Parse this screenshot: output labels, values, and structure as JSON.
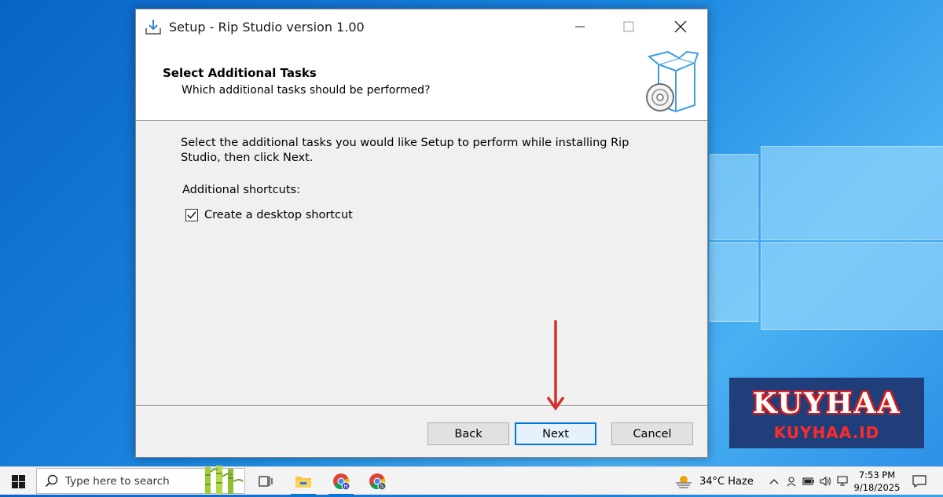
{
  "window": {
    "title": "Setup - Rip Studio version 1.00",
    "header_title": "Select Additional Tasks",
    "header_subtitle": "Which additional tasks should be performed?",
    "intro_text": "Select the additional tasks you would like Setup to perform while installing Rip Studio, then click Next.",
    "shortcuts_label": "Additional shortcuts:",
    "checkbox_label": "Create a desktop shortcut",
    "checkbox_checked": true,
    "buttons": {
      "back": "Back",
      "next": "Next",
      "cancel": "Cancel"
    }
  },
  "watermark": {
    "main": "KUYHAA",
    "sub": "KUYHAA.ID"
  },
  "taskbar": {
    "search_placeholder": "Type here to search",
    "weather_text": "34°C  Haze",
    "time": "7:53 PM",
    "date": "9/18/2025",
    "chrome_h_badge": "H",
    "chrome_s_badge": "S"
  },
  "colors": {
    "accent": "#0078d7",
    "arrow": "#d32f2f",
    "watermark_bg": "#1f3e7a"
  }
}
